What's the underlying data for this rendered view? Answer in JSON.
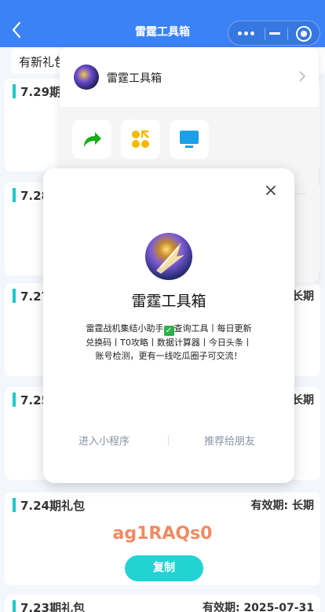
{
  "navbar": {
    "title": "雷霆工具箱"
  },
  "notice": {
    "text": "有新礼包"
  },
  "cards": [
    {
      "title": "7.29期礼包",
      "validity": ""
    },
    {
      "title": "7.28期礼包",
      "validity": ""
    },
    {
      "title": "7.27期礼包",
      "validity": "长期"
    },
    {
      "title": "7.25期礼包",
      "validity": "长期"
    },
    {
      "title": "7.24期礼包",
      "validity": "有效期: 长期",
      "code": "ag1RAQs0",
      "copy_label": "复制"
    },
    {
      "title": "7.23期礼包",
      "validity": "有效期: 2025-07-31"
    }
  ],
  "menu": {
    "name": "雷霆工具箱",
    "tiles": [
      {
        "icon": "share-arrow-icon",
        "label": "",
        "color": "#1aad19"
      },
      {
        "icon": "apps-icon",
        "label": "",
        "color": "#f5b800"
      },
      {
        "icon": "desktop-icon",
        "label": "",
        "color": "#1aa0e8"
      }
    ]
  },
  "dialog": {
    "name": "雷霆工具箱",
    "desc_1": "雷霆战机集结小助手",
    "desc_2": "查询工具丨每日更新兑换码丨T0攻略丨数据计算器丨今日头条丨账号检测，更有一线吃瓜圈子可交流！",
    "enter_label": "进入小程序",
    "share_label": "推荐给朋友"
  },
  "colors": {
    "navbar": "#3b82f6",
    "accent": "#1ec8c8",
    "code": "#f08a64"
  }
}
